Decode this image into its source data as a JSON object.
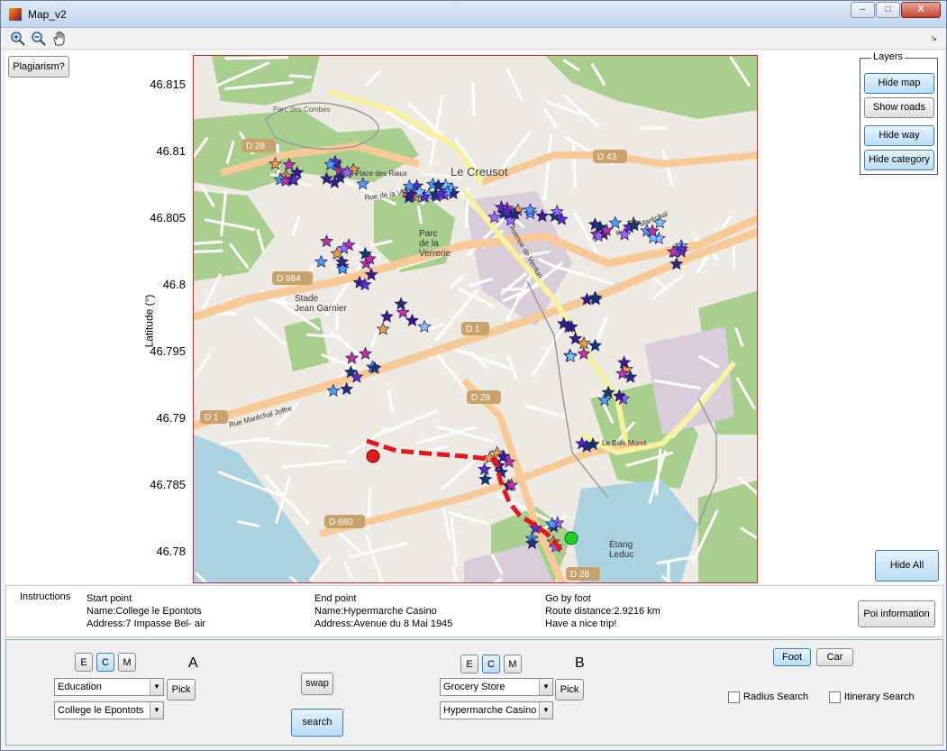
{
  "window": {
    "title": "Map_v2",
    "minimize": "–",
    "maximize": "□",
    "close": "X"
  },
  "toolbar": {
    "zoom_in_icon": "zoom-in-icon",
    "zoom_out_icon": "zoom-out-icon",
    "pan_icon": "pan-icon"
  },
  "figure": {
    "plagiarism_label": "Plagiarism?",
    "y_axis_label": "Latitude (°)",
    "y_ticks": [
      "46.815",
      "46.81",
      "46.805",
      "46.8",
      "46.795",
      "46.79",
      "46.785",
      "46.78"
    ],
    "map_labels": {
      "parc_combes": "Parc des Combes",
      "parc_verrerie": "Parc\nde la\nVerrerie",
      "stade": "Stade\nJean Garnier",
      "la_place": "La Place des Riaux",
      "le_creusot": "Le Creusot",
      "rue_verrerie": "Rue de la Verrerie",
      "rue_marechal": "Rue Maréchal Joffre",
      "avenue_verdun": "Avenue de Verdun",
      "rue_marechal_foch": "Rue du Maréchal",
      "bois_moret": "Le Bois Moret",
      "etang": "Étang\nLeduc",
      "d28_a": "D 28",
      "d28_b": "D 28",
      "d28_c": "D 28",
      "d43": "D 43",
      "d984": "D 984",
      "d1_a": "D 1",
      "d1_b": "D 1",
      "d680": "D 680"
    },
    "map_colors": {
      "background": "#ede9e3",
      "forest": "#a9cf8e",
      "road_major": "#f7c996",
      "road_yellow": "#f6f2a0",
      "water": "#aad3df",
      "industrial": "#d8cdd9",
      "route": "#e3161b",
      "start": "#e41a1c",
      "end": "#1fd11f"
    },
    "layers": {
      "title": "Layers",
      "hide_map": "Hide map",
      "show_roads": "Show roads",
      "hide_way": "Hide way",
      "hide_category": "Hide category"
    },
    "hide_all": "Hide All"
  },
  "instructions": {
    "heading": "Instructions",
    "start_point": "Start point",
    "start_name": "Name:College le Epontots",
    "start_address": "Address:7 Impasse Bel- air",
    "end_point": "End point",
    "end_name": "Name:Hypermarche Casino",
    "end_address": "Address:Avenue du 8 Mai 1945",
    "mode": "Go by foot",
    "distance": "Route distance:2.9216 km",
    "farewell": "Have a nice trip!",
    "poi_button": "Poi information"
  },
  "controls": {
    "a": {
      "letter": "A",
      "buttons": [
        "E",
        "C",
        "M"
      ],
      "active": "C",
      "category": "Education",
      "place": "College le Epontots",
      "pick": "Pick"
    },
    "b": {
      "letter": "B",
      "buttons": [
        "E",
        "C",
        "M"
      ],
      "active": "C",
      "category": "Grocery Store",
      "place": "Hypermarche Casino",
      "pick": "Pick"
    },
    "swap": "swap",
    "search": "search",
    "foot": "Foot",
    "car": "Car",
    "radius_search": "Radius Search",
    "itinerary_search": "Itinerary Search"
  }
}
